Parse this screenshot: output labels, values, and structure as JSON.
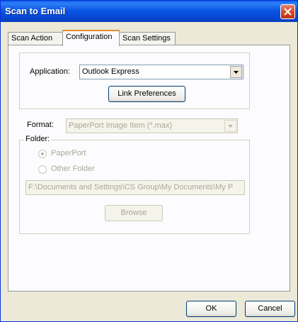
{
  "window": {
    "title": "Scan to Email"
  },
  "tabs": [
    {
      "label": "Scan Action"
    },
    {
      "label": "Configuration"
    },
    {
      "label": "Scan Settings"
    }
  ],
  "application": {
    "label": "Application:",
    "selected": "Outlook Express",
    "link_button": "Link Preferences"
  },
  "format": {
    "label": "Format:",
    "selected": "PaperPort Image Item (*.max)"
  },
  "folder": {
    "group_label": "Folder:",
    "option_paperport": "PaperPort",
    "option_other": "Other Folder",
    "path": "F:\\Documents and Settings\\CS Group\\My Documents\\My P",
    "browse_button": "Browse"
  },
  "footer": {
    "ok_label": "OK",
    "cancel_label": "Cancel"
  },
  "colors": {
    "titlebar": "#0a58e4",
    "active_tab_accent": "#e68b2c",
    "close_button": "#d64623"
  }
}
